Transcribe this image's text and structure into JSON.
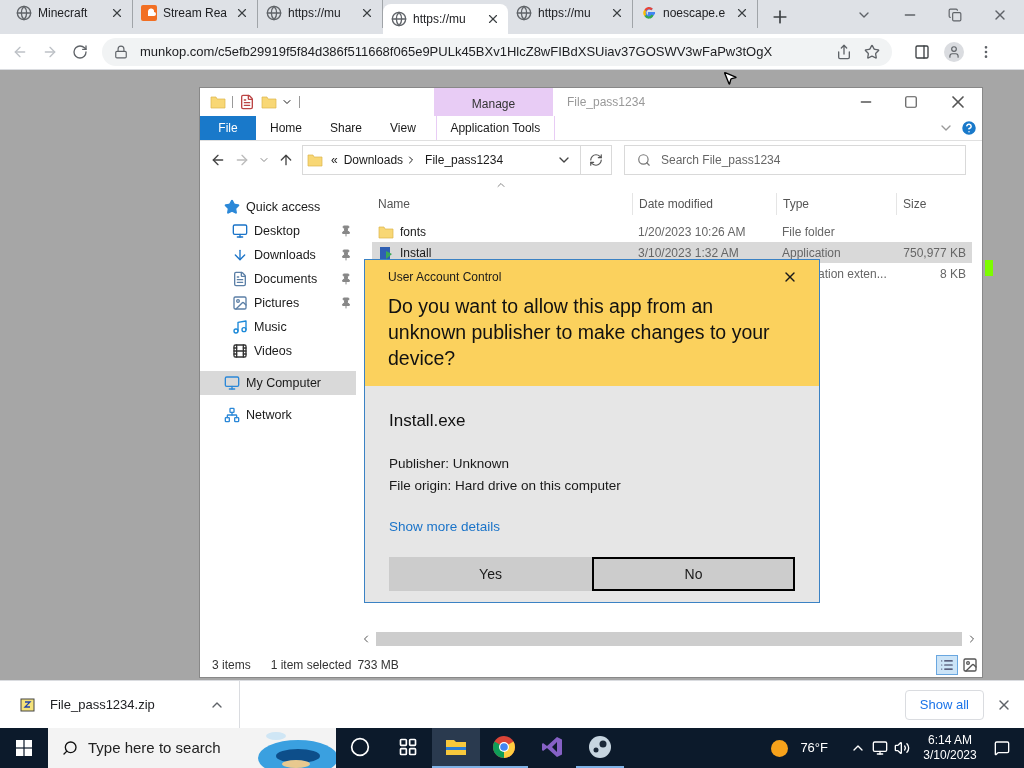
{
  "browser": {
    "tabs": [
      {
        "title": "Minecraft",
        "kind": "globe",
        "selected": false
      },
      {
        "title": "Stream Rea",
        "kind": "sound",
        "selected": false
      },
      {
        "title": "https://mu",
        "kind": "globe",
        "selected": false
      },
      {
        "title": "https://mu",
        "kind": "globe",
        "selected": true
      },
      {
        "title": "https://mu",
        "kind": "globe",
        "selected": false
      },
      {
        "title": "noescape.e",
        "kind": "google",
        "selected": false
      }
    ],
    "address": "munkop.com/c5efb29919f5f84d386f511668f065e9PULk45BXv1HlcZ8wFIBdXSUiav37GOSWV3wFaPw3tOgX"
  },
  "explorer": {
    "title": "File_pass1234",
    "context_tab": "Manage",
    "ribbon_tabs": [
      {
        "label": "File",
        "kind": "file"
      },
      {
        "label": "Home",
        "kind": "tab"
      },
      {
        "label": "Share",
        "kind": "tab"
      },
      {
        "label": "View",
        "kind": "tab"
      },
      {
        "label": "Application Tools",
        "kind": "context"
      }
    ],
    "path_prefix": "«",
    "breadcrumb": [
      "Downloads",
      "File_pass1234"
    ],
    "search": {
      "placeholder": "Search File_pass1234"
    },
    "sidebar": [
      {
        "label": "Quick access",
        "kind": "header",
        "pinned": false,
        "selected": false
      },
      {
        "label": "Desktop",
        "kind": "item",
        "pinned": true,
        "selected": false
      },
      {
        "label": "Downloads",
        "kind": "item",
        "pinned": true,
        "selected": false
      },
      {
        "label": "Documents",
        "kind": "item",
        "pinned": true,
        "selected": false
      },
      {
        "label": "Pictures",
        "kind": "item",
        "pinned": true,
        "selected": false
      },
      {
        "label": "Music",
        "kind": "item",
        "pinned": false,
        "selected": false
      },
      {
        "label": "Videos",
        "kind": "item",
        "pinned": false,
        "selected": false
      },
      {
        "label": "My Computer",
        "kind": "header",
        "pinned": false,
        "selected": true
      },
      {
        "label": "Network",
        "kind": "header",
        "pinned": false,
        "selected": false
      }
    ],
    "columns": [
      "Name",
      "Date modified",
      "Type",
      "Size"
    ],
    "rows": [
      {
        "kind": "folder",
        "name": "fonts",
        "date": "1/20/2023 10:26 AM",
        "type": "File folder",
        "size": "",
        "selected": false
      },
      {
        "kind": "app",
        "name": "Install",
        "date": "3/10/2023 1:32 AM",
        "type": "Application",
        "size": "750,977 KB",
        "selected": true
      },
      {
        "kind": "hidden",
        "type": "ation exten...",
        "size": "8 KB",
        "selected": false
      }
    ],
    "status": {
      "count": "3 items",
      "selection": "1 item selected",
      "size": "733 MB"
    }
  },
  "uac": {
    "header": "User Account Control",
    "question": "Do you want to allow this app from an unknown publisher to make changes to your device?",
    "app": "Install.exe",
    "publisher": "Publisher: Unknown",
    "origin": "File origin: Hard drive on this computer",
    "link": "Show more details",
    "buttons": [
      {
        "label": "Yes",
        "focused": false
      },
      {
        "label": "No",
        "focused": true
      }
    ]
  },
  "downloads": {
    "file": "File_pass1234.zip",
    "show_all": "Show all"
  },
  "taskbar": {
    "search": {
      "placeholder": "Type here to search"
    },
    "apps": [
      {
        "kind": "cortana",
        "selected": false,
        "open": false
      },
      {
        "kind": "taskview",
        "selected": false,
        "open": false
      },
      {
        "kind": "explorer",
        "selected": true,
        "open": true
      },
      {
        "kind": "chrome",
        "selected": false,
        "open": true
      },
      {
        "kind": "vs",
        "selected": false,
        "open": false
      },
      {
        "kind": "steam",
        "selected": false,
        "open": true
      }
    ],
    "weather": "76°F",
    "time": "6:14 AM",
    "date": "3/10/2023"
  }
}
